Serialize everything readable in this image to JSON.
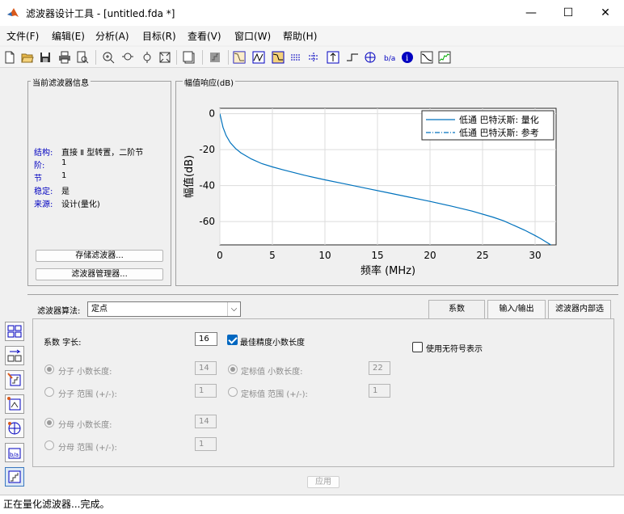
{
  "window": {
    "title": "滤波器设计工具 - [untitled.fda *]",
    "minimize": "—",
    "maximize": "☐",
    "close": "✕"
  },
  "menu": [
    "文件(F)",
    "编辑(E)",
    "分析(A)",
    "目标(R)",
    "查看(V)",
    "窗口(W)",
    "帮助(H)"
  ],
  "info_panel": {
    "title": "当前滤波器信息",
    "rows": [
      {
        "label": "结构:",
        "value": "直接 Ⅱ 型转置，二阶节"
      },
      {
        "label": "阶:",
        "value": "1"
      },
      {
        "label": "节",
        "value": "1"
      },
      {
        "label": "稳定:",
        "value": "是"
      },
      {
        "label": "来源:",
        "value": "设计(量化)"
      }
    ],
    "store_button": "存储滤波器...",
    "manager_button": "滤波器管理器..."
  },
  "plot_panel": {
    "title": "幅值响应(dB)"
  },
  "chart_data": {
    "type": "line",
    "xlabel": "频率 (MHz)",
    "ylabel": "幅值(dB)",
    "xlim": [
      0,
      32
    ],
    "ylim": [
      -73,
      3
    ],
    "xticks": [
      0,
      5,
      10,
      15,
      20,
      25,
      30
    ],
    "yticks": [
      0,
      -20,
      -40,
      -60
    ],
    "grid": true,
    "legend_position": "top-right",
    "series": [
      {
        "name": "低通 巴特沃斯: 量化",
        "style": "solid",
        "color": "#0072bd",
        "x": [
          0,
          0.1,
          0.3,
          0.6,
          1,
          1.5,
          2,
          3,
          4,
          5,
          6,
          8,
          10,
          12,
          14,
          16,
          18,
          20,
          22,
          24,
          26,
          27,
          28,
          29,
          30,
          30.5,
          31,
          31.5,
          31.8
        ],
        "y": [
          0,
          -2.5,
          -7.6,
          -12.2,
          -16.2,
          -19.4,
          -21.8,
          -25.2,
          -27.8,
          -29.6,
          -31.2,
          -34.2,
          -36.8,
          -39.2,
          -41.6,
          -44,
          -46.4,
          -48.8,
          -51.4,
          -54.2,
          -57.6,
          -59.6,
          -62.2,
          -64.8,
          -67.8,
          -69.4,
          -71.2,
          -73,
          -74.4
        ]
      },
      {
        "name": "低通 巴特沃斯: 参考",
        "style": "dashdot",
        "color": "#0072bd",
        "x": [],
        "y": []
      }
    ]
  },
  "algorithm": {
    "label": "滤波器算法:",
    "value": "定点"
  },
  "tabs": [
    "系数",
    "输入/输出",
    "滤波器内部选"
  ],
  "coeffs": {
    "wordlength_label": "系数 字长:",
    "wordlength_value": "16",
    "best_precision_label": "最佳精度小数长度",
    "unsigned_label": "使用无符号表示",
    "num_frac_label": "分子 小数长度:",
    "num_frac_value": "14",
    "num_range_label": "分子 范围 (+/-):",
    "num_range_value": "1",
    "scale_frac_label": "定标值 小数长度:",
    "scale_frac_value": "22",
    "scale_range_label": "定标值 范围 (+/-):",
    "scale_range_value": "1",
    "den_frac_label": "分母 小数长度:",
    "den_frac_value": "14",
    "den_range_label": "分母 范围 (+/-):",
    "den_range_value": "1"
  },
  "apply_button": "应用",
  "status": "正在量化滤波器...完成。"
}
